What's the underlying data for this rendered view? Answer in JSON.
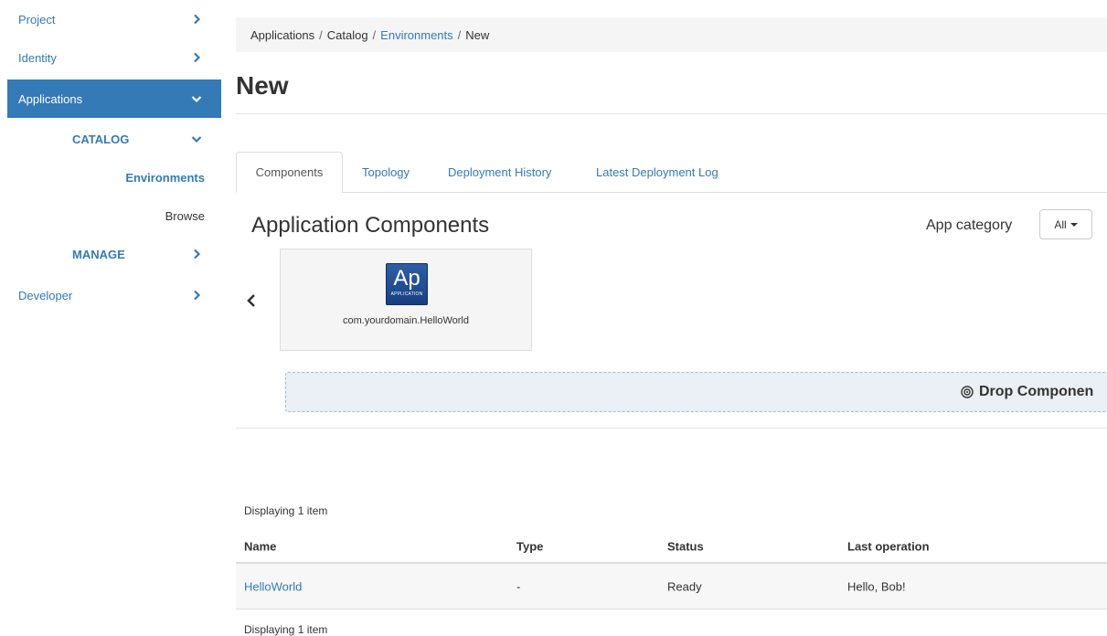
{
  "sidebar": {
    "items": [
      {
        "label": "Project"
      },
      {
        "label": "Identity"
      },
      {
        "label": "Applications"
      },
      {
        "label": "CATALOG"
      },
      {
        "label": "Environments"
      },
      {
        "label": "Browse"
      },
      {
        "label": "MANAGE"
      },
      {
        "label": "Developer"
      }
    ],
    "active_color": "#337ab7"
  },
  "breadcrumb": {
    "items": [
      "Applications",
      "Catalog",
      "Environments",
      "New"
    ],
    "separator": "/"
  },
  "page": {
    "title": "New"
  },
  "tabs": [
    {
      "label": "Components",
      "active": true
    },
    {
      "label": "Topology"
    },
    {
      "label": "Deployment History"
    },
    {
      "label": "Latest Deployment Log"
    }
  ],
  "components": {
    "title": "Application Components",
    "category_label": "App category",
    "category_value": "All",
    "items": [
      {
        "icon_text": "Ap",
        "icon_subtext": "APPLICATION",
        "name": "com.yourdomain.HelloWorld"
      }
    ],
    "drop_text": "Drop Componen"
  },
  "table": {
    "count_text": "Displaying 1 item",
    "columns": [
      "Name",
      "Type",
      "Status",
      "Last operation"
    ],
    "rows": [
      {
        "name": "HelloWorld",
        "type": "-",
        "status": "Ready",
        "last_operation": "Hello, Bob!"
      }
    ]
  },
  "colors": {
    "link": "#337ab7",
    "breadcrumb_bg": "#f5f5f5",
    "dropzone_bg": "#eaf0f6"
  }
}
